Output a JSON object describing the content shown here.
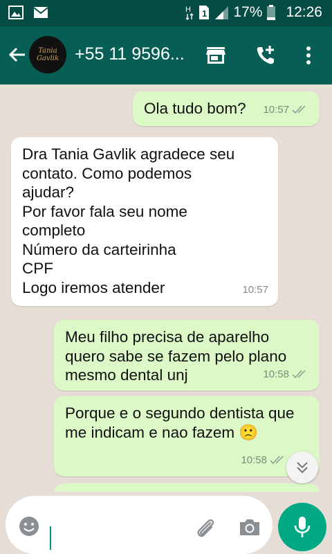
{
  "status_bar": {
    "battery_percent": "17%",
    "time": "12:26",
    "left_icons": [
      "image-icon",
      "mail-icon"
    ],
    "right_icons": [
      "h-data-icon",
      "sim-1-icon",
      "signal-icon",
      "battery-icon"
    ]
  },
  "header": {
    "contact_name": "+55 11 9596...",
    "avatar_text": "Tania Gavlik",
    "icons": [
      "back-arrow-icon",
      "store-icon",
      "add-call-icon",
      "more-vertical-icon"
    ]
  },
  "messages": [
    {
      "direction": "out",
      "text": "Ola tudo bom?",
      "time": "10:57",
      "status": "read"
    },
    {
      "direction": "in",
      "text": "Dra Tania Gavlik agradece seu\ncontato. Como podemos\najudar?\nPor favor fala seu nome\ncompleto\nNúmero da carteirinha\nCPF\nLogo iremos atender",
      "time": "10:57"
    },
    {
      "direction": "out",
      "text": "Meu filho precisa de aparelho\nquero sabe se fazem pelo plano\nmesmo dental unj",
      "time": "10:58",
      "status": "read"
    },
    {
      "direction": "out",
      "text": "Porque e o segundo dentista que\nme indicam e nao fazem 🙁",
      "time": "10:58",
      "status": "read"
    }
  ],
  "input": {
    "value": "",
    "icons": [
      "emoji-icon",
      "paperclip-icon",
      "camera-icon",
      "microphone-icon"
    ]
  },
  "colors": {
    "status_bar": "#054d44",
    "app_bar": "#075e54",
    "outgoing_bubble": "#dcf8c6",
    "incoming_bubble": "#ffffff",
    "mic_button": "#00a884",
    "chat_bg": "#e6ded6"
  }
}
